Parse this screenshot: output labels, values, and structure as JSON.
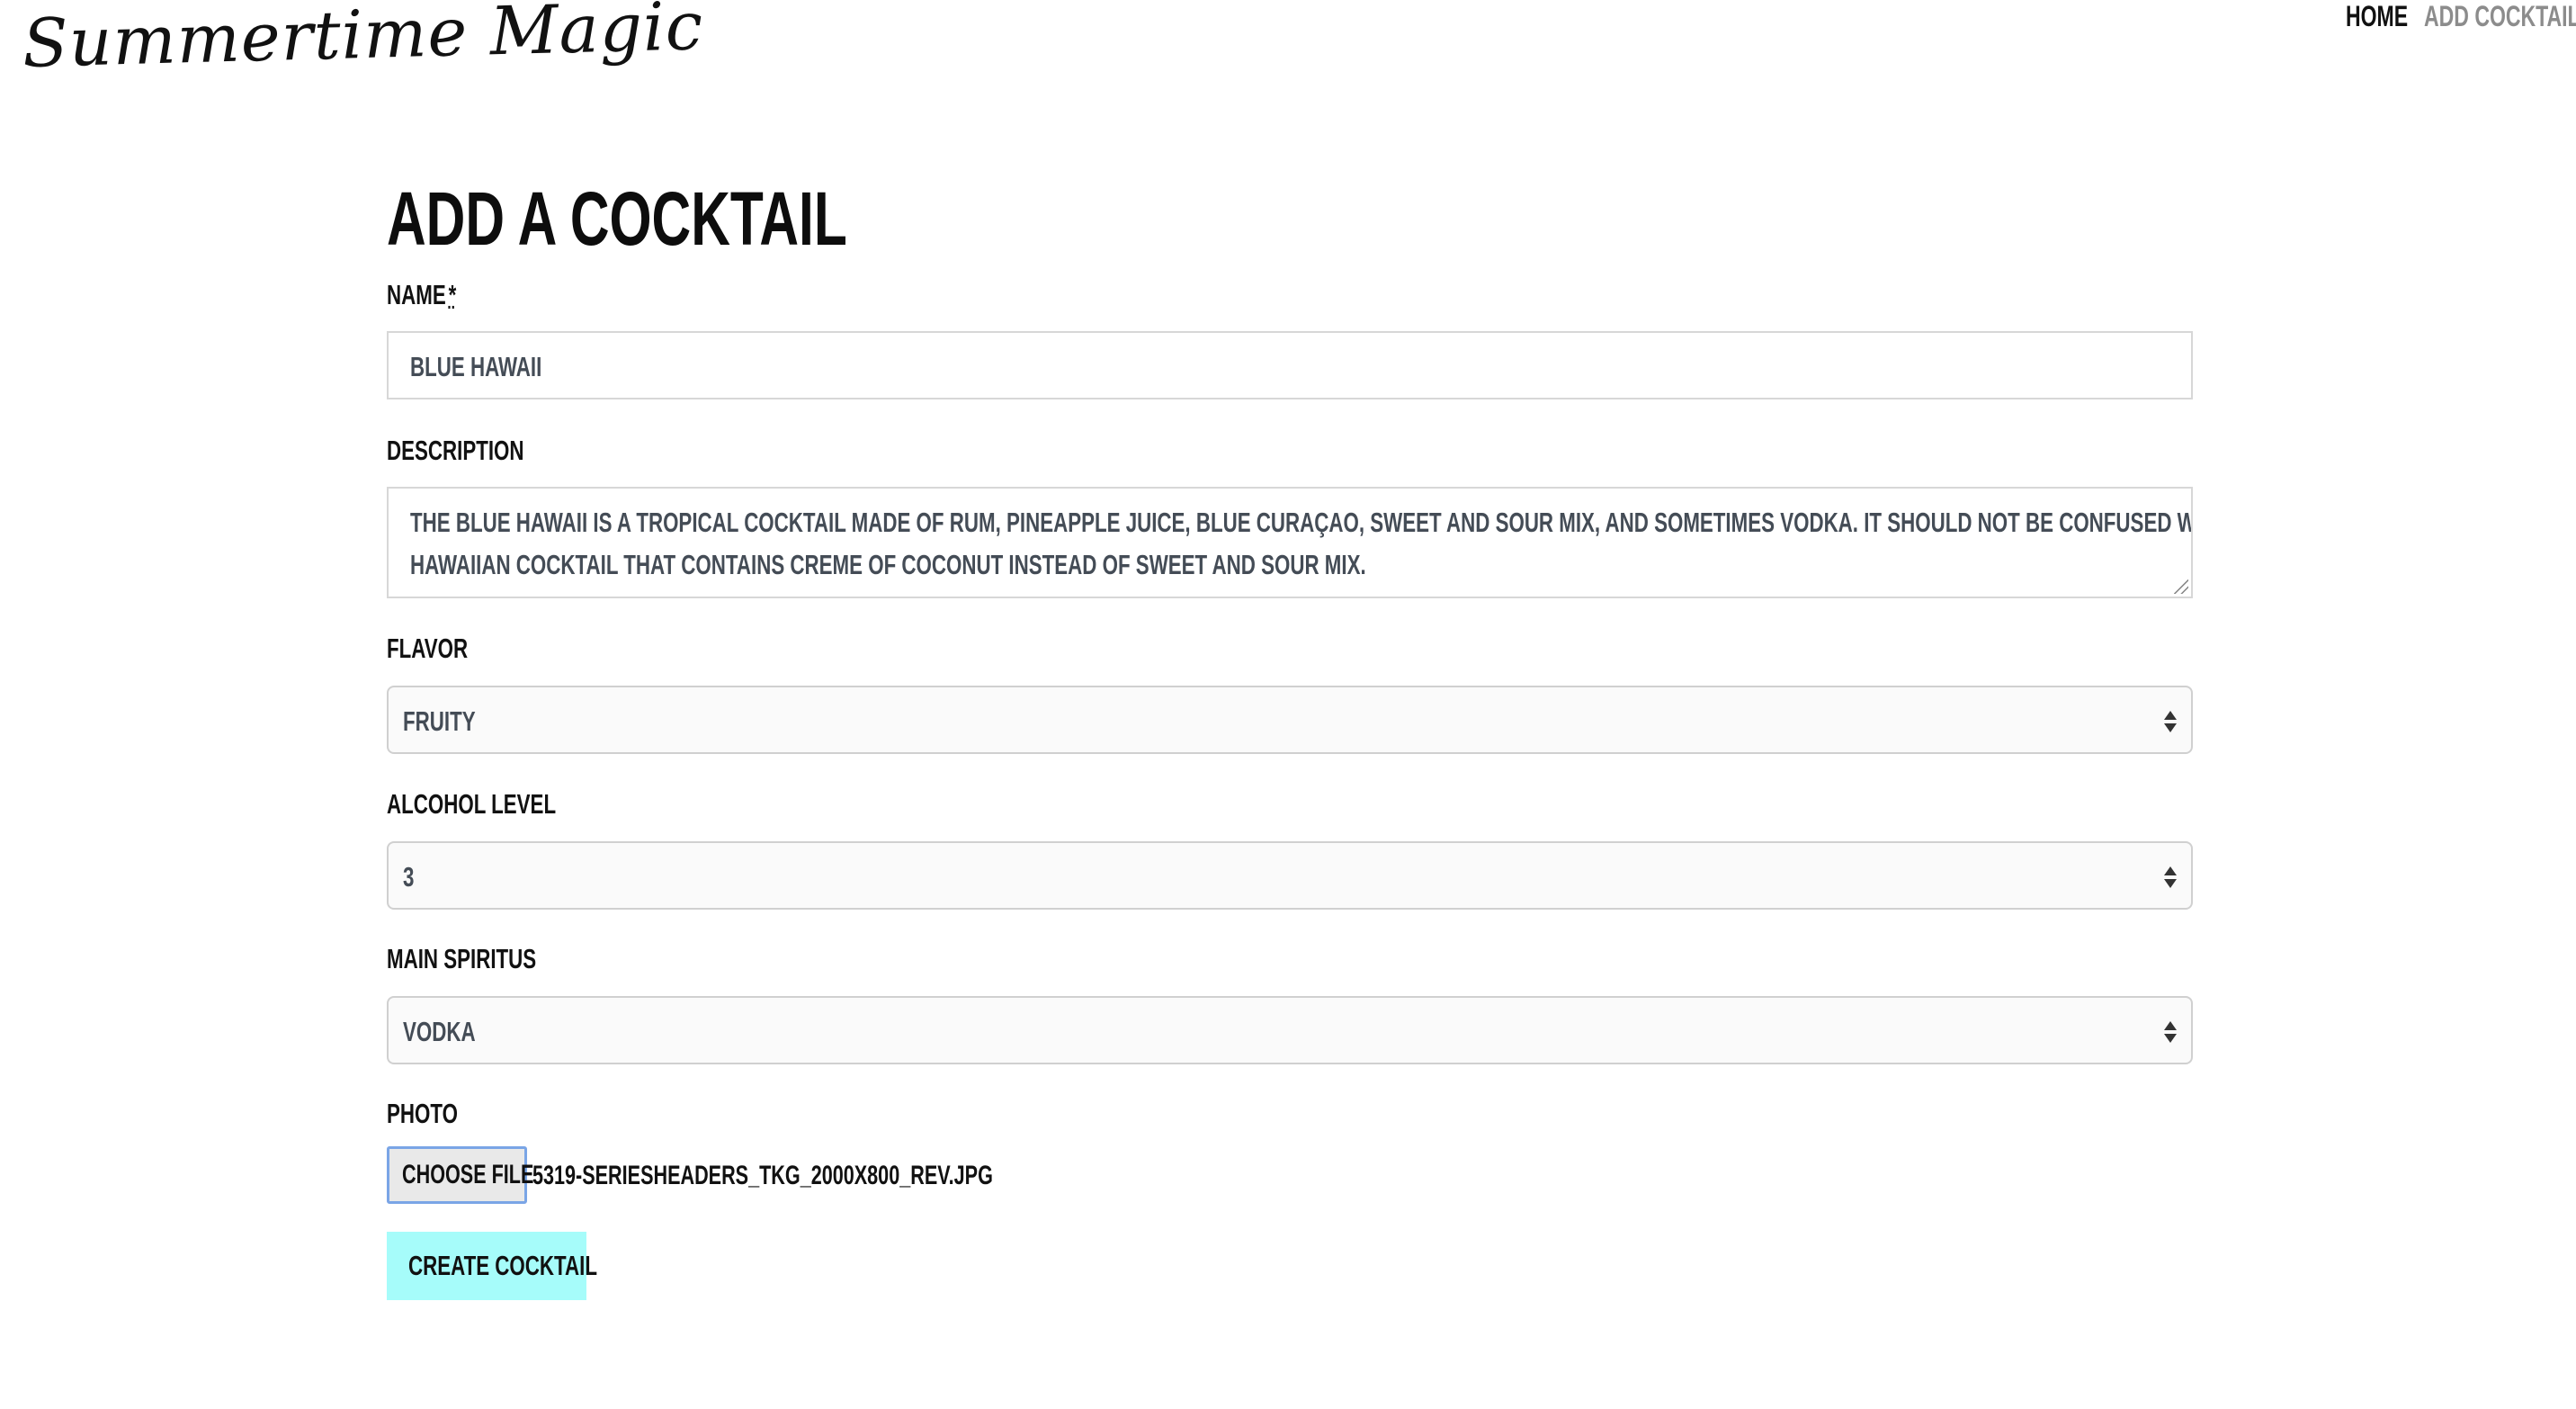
{
  "header": {
    "logo_text": "Summertime Magic",
    "nav": {
      "home": "HOME",
      "add_cocktail": "ADD COCKTAIL"
    }
  },
  "form": {
    "title": "ADD A COCKTAIL",
    "name": {
      "label": "NAME",
      "required_mark": "*",
      "value": "BLUE HAWAII"
    },
    "description": {
      "label": "DESCRIPTION",
      "value_line1": "THE BLUE HAWAII IS A TROPICAL COCKTAIL MADE OF RUM, PINEAPPLE JUICE, BLUE CURAÇAO, SWEET AND SOUR MIX, AND SOMETIMES VODKA. IT SHOULD NOT BE CONFUSED WITH THE SIMILARLY NAMED BLUE",
      "value_line2": "HAWAIIAN COCKTAIL THAT CONTAINS CREME OF COCONUT INSTEAD OF SWEET AND SOUR MIX."
    },
    "flavor": {
      "label": "FLAVOR",
      "selected": "FRUITY"
    },
    "alcohol_level": {
      "label": "ALCOHOL LEVEL",
      "selected": "3"
    },
    "main_spiritus": {
      "label": "MAIN SPIRITUS",
      "selected": "VODKA"
    },
    "photo": {
      "label": "PHOTO",
      "button_label": "CHOOSE FILE",
      "file_name": "5319-SERIESHEADERS_TKG_2000X800_REV.JPG"
    },
    "submit_label": "CREATE COCKTAIL"
  }
}
